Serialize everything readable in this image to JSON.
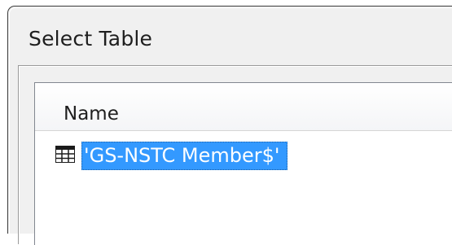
{
  "dialog": {
    "title": "Select Table"
  },
  "table_list": {
    "column_header": "Name",
    "items": [
      {
        "label": "'GS-NSTC Member$'",
        "icon": "table-icon",
        "selected": true
      }
    ]
  },
  "colors": {
    "selection": "#3399ff",
    "dialog_background": "#f0f0f0"
  }
}
